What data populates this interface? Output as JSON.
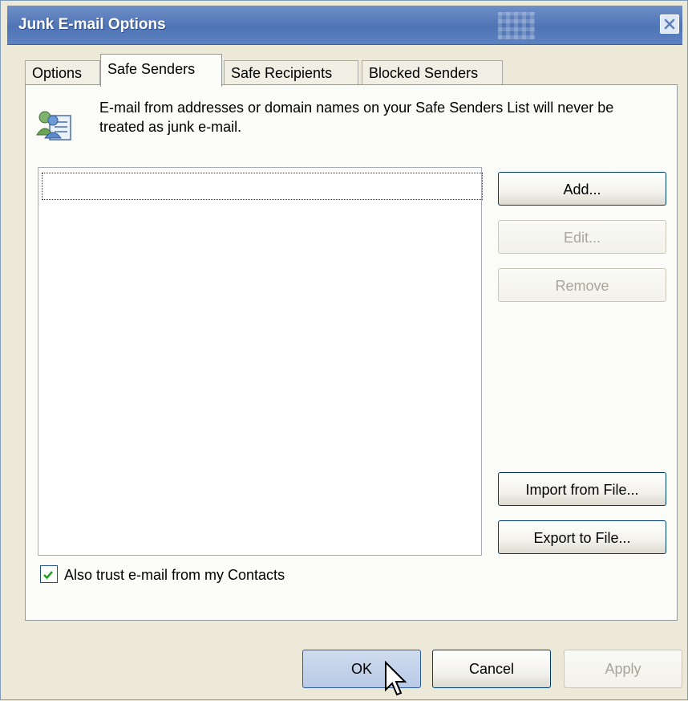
{
  "window": {
    "title": "Junk E-mail Options"
  },
  "tabs": [
    {
      "label": "Options",
      "active": false
    },
    {
      "label": "Safe Senders",
      "active": true
    },
    {
      "label": "Safe Recipients",
      "active": false
    },
    {
      "label": "Blocked Senders",
      "active": false
    }
  ],
  "panel": {
    "icon": "contacts-icon",
    "description": "E-mail from addresses or domain names on your Safe Senders List will never be treated as junk e-mail.",
    "list_items": [],
    "buttons": {
      "add": "Add...",
      "edit": "Edit...",
      "remove": "Remove",
      "import": "Import from File...",
      "export": "Export to File..."
    },
    "trust_contacts": {
      "label": "Also trust e-mail from my Contacts",
      "checked": true
    }
  },
  "footer": {
    "ok": "OK",
    "cancel": "Cancel",
    "apply": "Apply"
  },
  "colors": {
    "titlebar": "#5d82c0",
    "dialog_bg": "#ece9d8",
    "button_border": "#003c74"
  }
}
